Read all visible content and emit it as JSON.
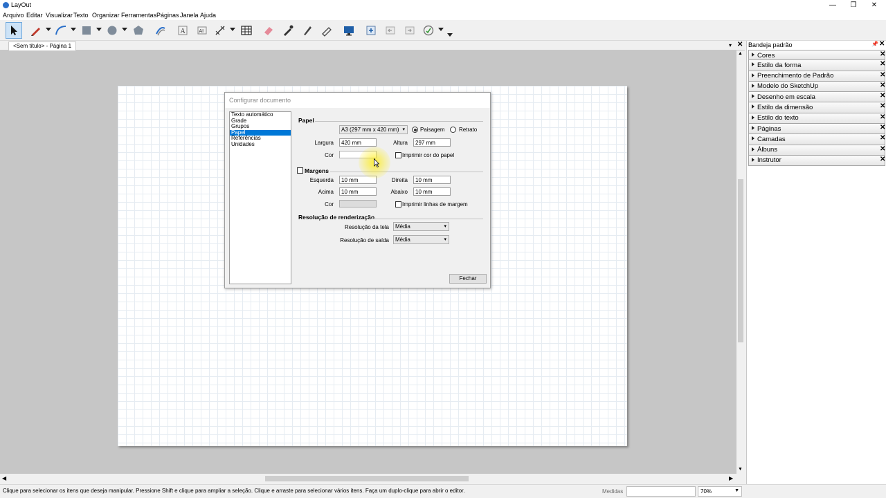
{
  "window": {
    "title": "LayOut",
    "minimize": "—",
    "restore": "❐",
    "close": "✕"
  },
  "menu": [
    "Arquivo",
    "Editar",
    "Visualizar",
    "Texto",
    "Organizar",
    "Ferramentas",
    "Páginas",
    "Janela",
    "Ajuda"
  ],
  "toolbar": {
    "tools": [
      "select-icon",
      "pencil-icon",
      "arc-icon",
      "rectangle-icon",
      "circle-icon",
      "polygon-icon",
      "offset-icon",
      "text-icon",
      "label-icon",
      "dimension-icon",
      "table-icon",
      "eraser-icon",
      "style-eyedropper-icon",
      "split-icon",
      "join-icon",
      "presentation-icon",
      "add-page-icon",
      "previous-page-icon",
      "next-page-icon",
      "sketchup-model-icon"
    ]
  },
  "tab": {
    "label": "<Sem título> - Página 1",
    "menu": "▾",
    "close": "✕"
  },
  "dialog": {
    "title": "Configurar documento",
    "categories": [
      "Texto automático",
      "Grade",
      "Grupos",
      "Papel",
      "Referências",
      "Unidades"
    ],
    "selected_category": "Papel",
    "paper": {
      "heading": "Papel",
      "size": "A3 (297 mm x 420 mm)",
      "landscape": "Paisagem",
      "portrait": "Retrato",
      "orientation": "Paisagem",
      "width_label": "Largura",
      "width": "420 mm",
      "height_label": "Altura",
      "height": "297 mm",
      "color_label": "Cor",
      "print_color": "Imprimir cor do papel"
    },
    "margins": {
      "heading": "Margens",
      "left_label": "Esquerda",
      "left": "10 mm",
      "right_label": "Direita",
      "right": "10 mm",
      "top_label": "Acima",
      "top": "10 mm",
      "bottom_label": "Abaixo",
      "bottom": "10 mm",
      "color_label": "Cor",
      "print_lines": "Imprimir linhas de margem"
    },
    "render": {
      "heading": "Resolução de renderização",
      "screen_label": "Resolução da tela",
      "screen": "Média",
      "output_label": "Resolução de saída",
      "output": "Média"
    },
    "close_button": "Fechar"
  },
  "tray": {
    "title": "Bandeja padrão",
    "panels": [
      "Cores",
      "Estilo da forma",
      "Preenchimento de Padrão",
      "Modelo do SketchUp",
      "Desenho em escala",
      "Estilo da dimensão",
      "Estilo do texto",
      "Páginas",
      "Camadas",
      "Álbuns",
      "Instrutor"
    ]
  },
  "status": {
    "message": "Clique para selecionar os itens que deseja manipular. Pressione Shift e clique para ampliar a seleção. Clique e arraste para selecionar vários itens. Faça um duplo-clique para abrir o editor.",
    "measurements_label": "Medidas",
    "zoom": "70%"
  },
  "colors": {
    "selection": "#0078d7",
    "canvas": "#c6c6c6",
    "highlight": "#ffec00"
  }
}
